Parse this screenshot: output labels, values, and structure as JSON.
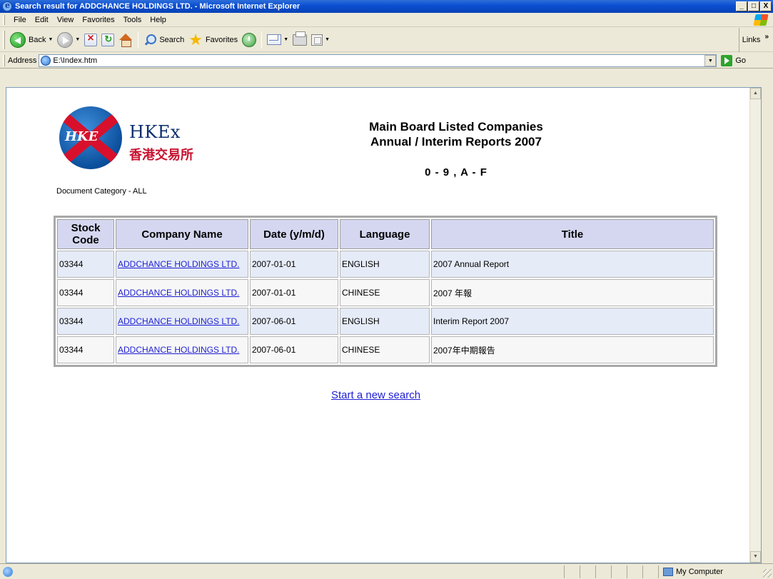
{
  "window": {
    "title": "Search result for ADDCHANCE HOLDINGS LTD. - Microsoft Internet Explorer",
    "controls": [
      "_",
      "□",
      "X"
    ]
  },
  "menu": [
    "File",
    "Edit",
    "View",
    "Favorites",
    "Tools",
    "Help"
  ],
  "toolbar": {
    "back_label": "Back",
    "search_label": "Search",
    "favorites_label": "Favorites",
    "links_label": "Links",
    "links_chevron": "»"
  },
  "address": {
    "label": "Address",
    "value": "E:\\Index.htm",
    "go_label": "Go"
  },
  "page": {
    "logo": {
      "globe_text": "HKE",
      "wordmark": "HKEx",
      "chinese": "香港交易所"
    },
    "heading_line1": "Main Board Listed Companies",
    "heading_line2": "Annual / Interim Reports 2007",
    "range": "0 - 9 , A - F",
    "doc_category": "Document Category - ALL",
    "table": {
      "headers": [
        "Stock Code",
        "Company Name",
        "Date (y/m/d)",
        "Language",
        "Title"
      ],
      "rows": [
        {
          "code": "03344",
          "company": "ADDCHANCE HOLDINGS LTD.",
          "date": "2007-01-01",
          "language": "ENGLISH",
          "title": "2007 Annual Report"
        },
        {
          "code": "03344",
          "company": "ADDCHANCE HOLDINGS LTD.",
          "date": "2007-01-01",
          "language": "CHINESE",
          "title": "2007 年報"
        },
        {
          "code": "03344",
          "company": "ADDCHANCE HOLDINGS LTD.",
          "date": "2007-06-01",
          "language": "ENGLISH",
          "title": "Interim Report 2007"
        },
        {
          "code": "03344",
          "company": "ADDCHANCE HOLDINGS LTD.",
          "date": "2007-06-01",
          "language": "CHINESE",
          "title": "2007年中期報告"
        }
      ]
    },
    "new_search_link": "Start a new search"
  },
  "status": {
    "zone": "My Computer"
  },
  "colors": {
    "titlebar": "#0a4ed0",
    "table_header": "#d4d7ef",
    "row_odd": "#e5ebf7",
    "row_even": "#f7f7f7",
    "link": "#1e1ed2"
  }
}
